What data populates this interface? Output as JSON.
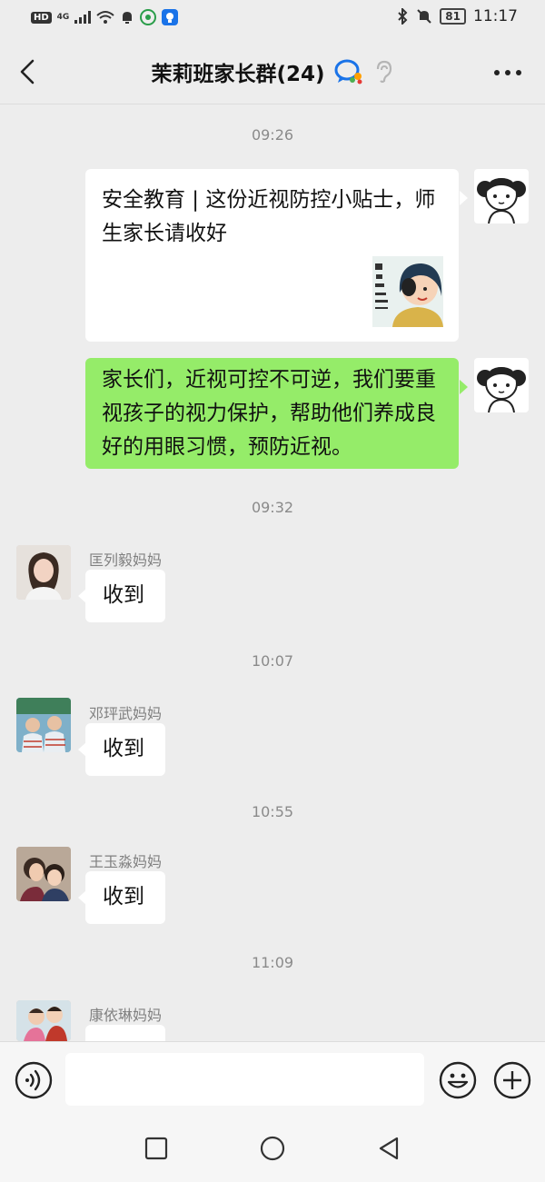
{
  "status_bar": {
    "hd": "HD",
    "network": "4G",
    "battery": "81",
    "time": "11:17"
  },
  "header": {
    "title": "茉莉班家长群(24)"
  },
  "messages": {
    "t1": "09:26",
    "card_text": "安全教育 | 这份近视防控小贴士，师生家长请收好",
    "green_text": "家长们，近视可控不可逆，我们要重视孩子的视力保护，帮助他们养成良好的用眼习惯，预防近视。",
    "t2": "09:32",
    "m1": {
      "sender": "匡列毅妈妈",
      "text": "收到"
    },
    "t3": "10:07",
    "m2": {
      "sender": "邓玶武妈妈",
      "text": "收到"
    },
    "t4": "10:55",
    "m3": {
      "sender": "王玉淼妈妈",
      "text": "收到"
    },
    "t5": "11:09",
    "m4": {
      "sender": "康依琳妈妈"
    }
  },
  "colors": {
    "bg": "#ededed",
    "my_bubble": "#95ec69",
    "card": "#ffffff"
  },
  "icons": [
    "back-arrow-icon",
    "wechat-bot-icon",
    "ear-icon",
    "more-icon",
    "voice-icon",
    "emoji-icon",
    "plus-icon",
    "nav-square-icon",
    "nav-home-icon",
    "nav-back-icon"
  ]
}
